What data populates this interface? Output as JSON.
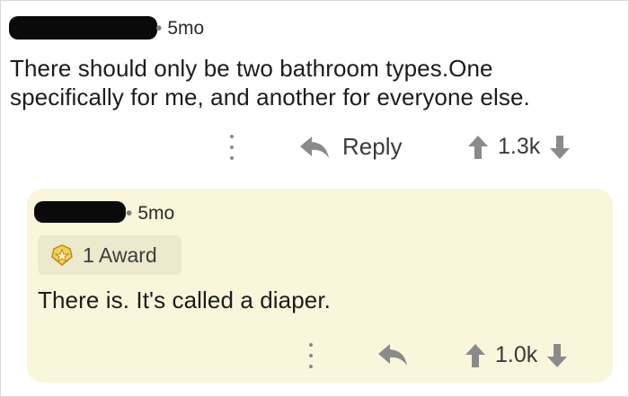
{
  "parent_comment": {
    "age": "5mo",
    "text_line1": "There should only be two bathroom types.One",
    "text_line2": "specifically for me, and another for everyone else.",
    "reply_label": "Reply",
    "score": "1.3k"
  },
  "child_comment": {
    "age": "5mo",
    "award_label": "1 Award",
    "text": "There is. It's called a diaper.",
    "score": "1.0k"
  },
  "colors": {
    "card_background": "#f9f6dc",
    "award_background": "#ece9cd",
    "icon_gray": "#8a8a8a",
    "award_gold": "#e8b33a"
  },
  "icons": {
    "more": "kebab-vertical-icon",
    "reply": "reply-arrow-icon",
    "upvote": "arrow-up-icon",
    "downvote": "arrow-down-icon",
    "award": "award-badge-icon"
  }
}
